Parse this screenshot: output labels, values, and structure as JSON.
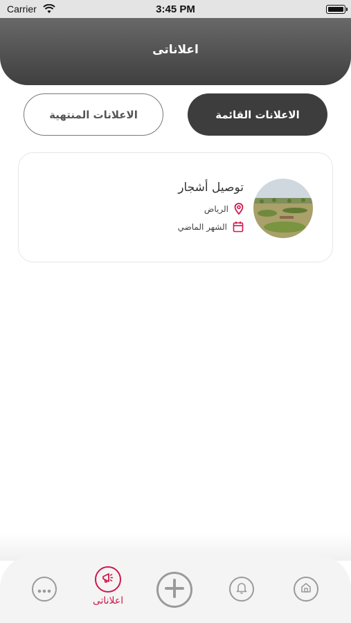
{
  "status_bar": {
    "carrier": "Carrier",
    "time": "3:45 PM"
  },
  "header": {
    "title": "اعلاناتى"
  },
  "tabs": [
    {
      "label": "الاعلانات القائمة",
      "active": true
    },
    {
      "label": "الاعلانات المنتهية",
      "active": false
    }
  ],
  "ads": [
    {
      "title": "توصيل أشجار",
      "city": "الرياض",
      "date": "الشهر الماضي"
    }
  ],
  "bottom_nav": {
    "items": [
      {
        "icon": "more-icon"
      },
      {
        "icon": "megaphone-icon",
        "label": "اعلاناتى",
        "active": true
      },
      {
        "icon": "plus-icon"
      },
      {
        "icon": "bell-icon"
      },
      {
        "icon": "home-icon"
      }
    ]
  },
  "colors": {
    "accent": "#d0164b",
    "header": "#4a4a4a",
    "active_tab": "#3d3d3d",
    "icon_gray": "#9a9a9a"
  }
}
